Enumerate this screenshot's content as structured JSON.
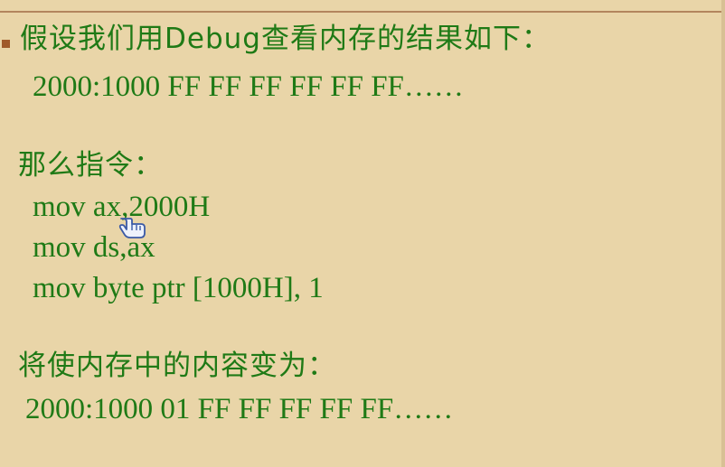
{
  "slide": {
    "bullet_color": "#a05a2a",
    "text_color": "#1f7a16",
    "background": "#e9d5a8",
    "heading": "假设我们用Debug查看内存的结果如下：",
    "memory_before": "2000:1000 FF FF FF FF FF FF……",
    "instructions_label": "那么指令：",
    "instructions": [
      "mov ax,2000H",
      "mov ds,ax",
      "mov byte ptr [1000H], 1"
    ],
    "result_label": "将使内存中的内容变为：",
    "memory_after": "2000:1000 01 FF FF FF FF FF……"
  },
  "cursor": {
    "icon": "hand-pointer-icon"
  }
}
